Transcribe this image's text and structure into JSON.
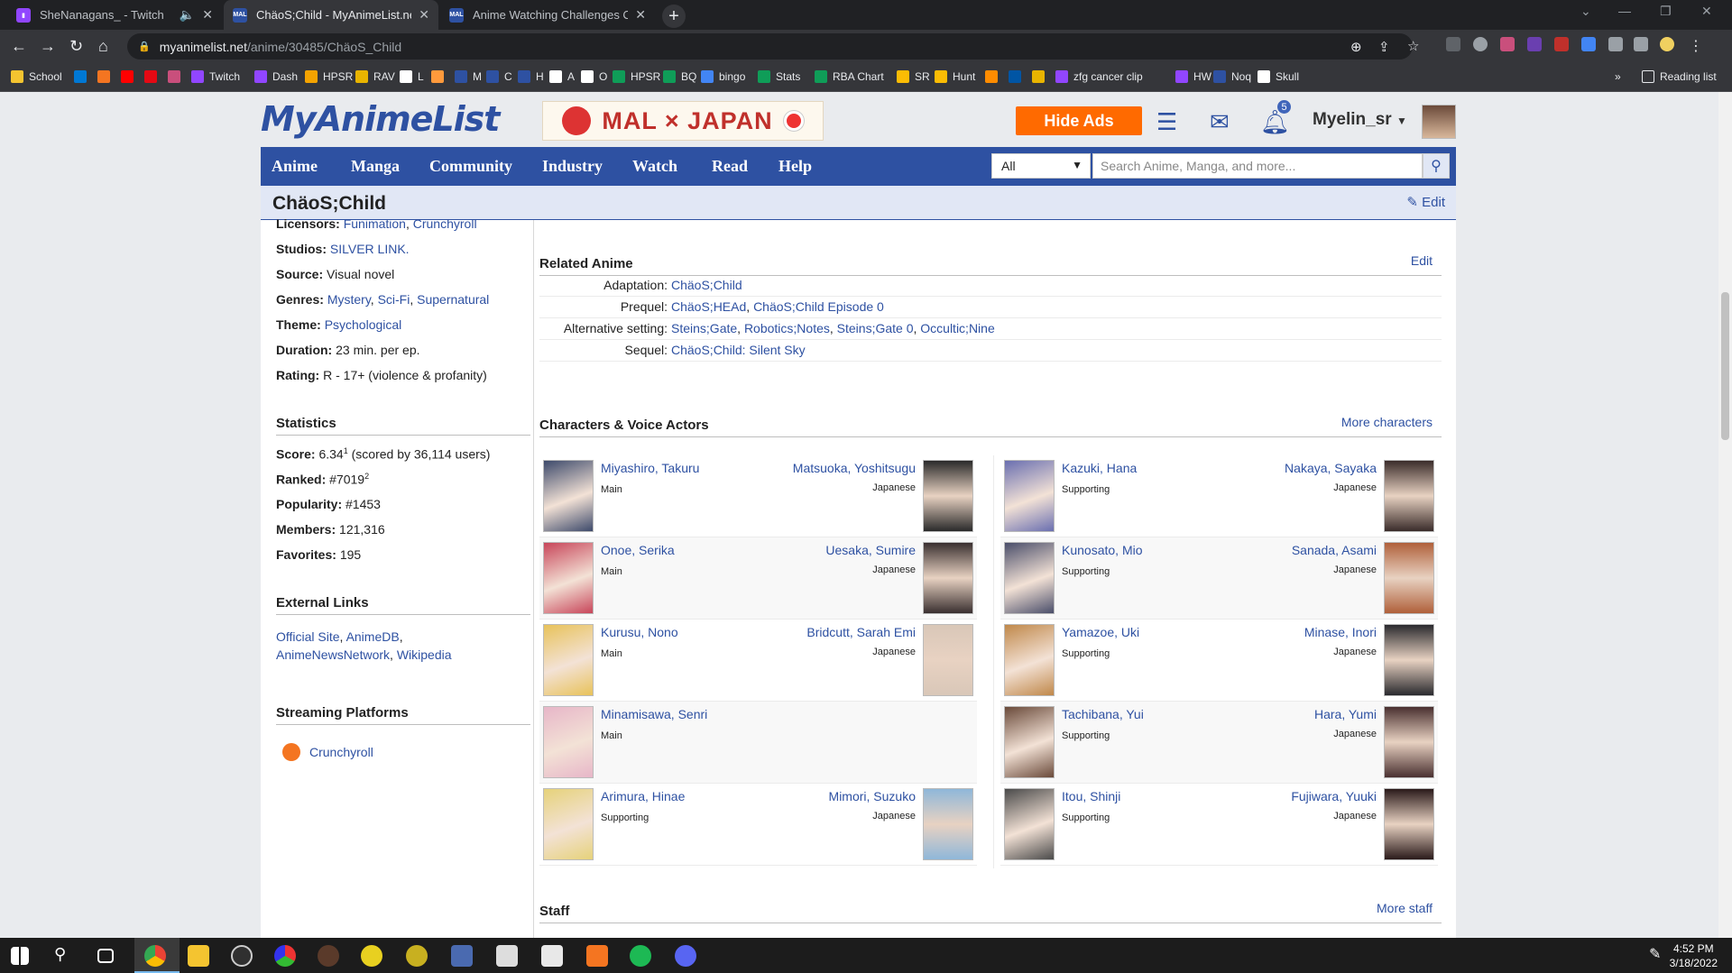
{
  "browser": {
    "tabs": [
      {
        "title": "SheNanagans_ - Twitch",
        "active": false,
        "color": "#9146ff"
      },
      {
        "title": "ChäoS;Child - MyAnimeList.net",
        "active": true,
        "color": "#2e51a2"
      },
      {
        "title": "Anime Watching Challenges Clu...",
        "active": false,
        "color": "#2e51a2"
      }
    ],
    "url_host": "myanimelist.net",
    "url_path": "/anime/30485/ChäoS_Child",
    "bookmarks": [
      {
        "label": "School",
        "color": "#f4c430"
      },
      {
        "label": "",
        "color": "#0078d4"
      },
      {
        "label": "",
        "color": "#f47521"
      },
      {
        "label": "",
        "color": "#ff0000"
      },
      {
        "label": "",
        "color": "#e50914"
      },
      {
        "label": "",
        "color": "#c94f7c"
      },
      {
        "label": "Twitch",
        "color": "#9146ff"
      },
      {
        "label": "Dash",
        "color": "#9146ff"
      },
      {
        "label": "HPSR",
        "color": "#f4a300"
      },
      {
        "label": "RAV",
        "color": "#e8b400"
      },
      {
        "label": "L",
        "color": "#ffffff"
      },
      {
        "label": "",
        "color": "#ff9a3c"
      },
      {
        "label": "M",
        "color": "#2e51a2"
      },
      {
        "label": "C",
        "color": "#2e51a2"
      },
      {
        "label": "H",
        "color": "#2e51a2"
      },
      {
        "label": "A",
        "color": "#ffffff"
      },
      {
        "label": "O",
        "color": "#ffffff"
      },
      {
        "label": "HPSR",
        "color": "#0f9d58"
      },
      {
        "label": "BQ",
        "color": "#0f9d58"
      },
      {
        "label": "bingo",
        "color": "#4285f4"
      },
      {
        "label": "Stats",
        "color": "#0f9d58"
      },
      {
        "label": "RBA Chart",
        "color": "#0f9d58"
      },
      {
        "label": "SR",
        "color": "#fbbc04"
      },
      {
        "label": "Hunt",
        "color": "#fbbc04"
      },
      {
        "label": "",
        "color": "#ff8c00"
      },
      {
        "label": "",
        "color": "#0055a4"
      },
      {
        "label": "",
        "color": "#e8b400"
      },
      {
        "label": "zfg cancer clip",
        "color": "#9146ff"
      },
      {
        "label": "HW",
        "color": "#9146ff"
      },
      {
        "label": "Noq",
        "color": "#2e51a2"
      },
      {
        "label": "Skull",
        "color": "#ffffff"
      }
    ],
    "bookmarks_overflow": "»",
    "reading_list": "Reading list"
  },
  "header": {
    "logo": "MyAnimeList",
    "banner": "MAL × JAPAN",
    "hide_ads": "Hide Ads",
    "notif_count": "5",
    "username": "Myelin_sr"
  },
  "nav": {
    "items": [
      "Anime",
      "Manga",
      "Community",
      "Industry",
      "Watch",
      "Read",
      "Help"
    ],
    "select_value": "All",
    "search_placeholder": "Search Anime, Manga, and more..."
  },
  "title": {
    "text": "ChäoS;Child",
    "edit": "Edit"
  },
  "info": {
    "licensors_label": "Licensors:",
    "licensors": [
      "Funimation",
      "Crunchyroll"
    ],
    "studios_label": "Studios:",
    "studios": "SILVER LINK.",
    "source_label": "Source:",
    "source": "Visual novel",
    "genres_label": "Genres:",
    "genres": [
      "Mystery",
      "Sci-Fi",
      "Supernatural"
    ],
    "theme_label": "Theme:",
    "theme": "Psychological",
    "duration_label": "Duration:",
    "duration": "23 min. per ep.",
    "rating_label": "Rating:",
    "rating": "R - 17+ (violence & profanity)"
  },
  "statistics": {
    "heading": "Statistics",
    "score_label": "Score:",
    "score": "6.34",
    "score_sup": "1",
    "score_note": "(scored by 36,114 users)",
    "ranked_label": "Ranked:",
    "ranked": "#7019",
    "ranked_sup": "2",
    "popularity_label": "Popularity:",
    "popularity": "#1453",
    "members_label": "Members:",
    "members": "121,316",
    "favorites_label": "Favorites:",
    "favorites": "195"
  },
  "external_links": {
    "heading": "External Links",
    "links": [
      "Official Site",
      "AnimeDB",
      "AnimeNewsNetwork",
      "Wikipedia"
    ]
  },
  "streaming": {
    "heading": "Streaming Platforms",
    "platforms": [
      "Crunchyroll"
    ]
  },
  "related": {
    "heading": "Related Anime",
    "edit": "Edit",
    "rows": [
      {
        "label": "Adaptation:",
        "values": [
          "ChäoS;Child"
        ]
      },
      {
        "label": "Prequel:",
        "values": [
          "ChäoS;HEAd",
          "ChäoS;Child Episode 0"
        ]
      },
      {
        "label": "Alternative setting:",
        "values": [
          "Steins;Gate",
          "Robotics;Notes",
          "Steins;Gate 0",
          "Occultic;Nine"
        ]
      },
      {
        "label": "Sequel:",
        "values": [
          "ChäoS;Child: Silent Sky"
        ]
      }
    ]
  },
  "characters": {
    "heading": "Characters & Voice Actors",
    "more": "More characters",
    "left": [
      {
        "name": "Miyashiro, Takuru",
        "role": "Main",
        "va": "Matsuoka, Yoshitsugu",
        "lang": "Japanese",
        "ccolor": "#3d4a6b",
        "vcolor": "#2a2a2a"
      },
      {
        "name": "Onoe, Serika",
        "role": "Main",
        "va": "Uesaka, Sumire",
        "lang": "Japanese",
        "ccolor": "#c8465a",
        "vcolor": "#3a3030"
      },
      {
        "name": "Kurusu, Nono",
        "role": "Main",
        "va": "Bridcutt, Sarah Emi",
        "lang": "Japanese",
        "ccolor": "#e8c25a",
        "vcolor": "#d9c7b8"
      },
      {
        "name": "Minamisawa, Senri",
        "role": "Main",
        "va": "",
        "lang": "",
        "ccolor": "#e7b6c8",
        "vcolor": ""
      },
      {
        "name": "Arimura, Hinae",
        "role": "Supporting",
        "va": "Mimori, Suzuko",
        "lang": "Japanese",
        "ccolor": "#e6d27a",
        "vcolor": "#8fb7d9"
      }
    ],
    "right": [
      {
        "name": "Kazuki, Hana",
        "role": "Supporting",
        "va": "Nakaya, Sayaka",
        "lang": "Japanese",
        "ccolor": "#6a6fb0",
        "vcolor": "#3a2c2a"
      },
      {
        "name": "Kunosato, Mio",
        "role": "Supporting",
        "va": "Sanada, Asami",
        "lang": "Japanese",
        "ccolor": "#4a4e6a",
        "vcolor": "#b0603a"
      },
      {
        "name": "Yamazoe, Uki",
        "role": "Supporting",
        "va": "Minase, Inori",
        "lang": "Japanese",
        "ccolor": "#c0884a",
        "vcolor": "#2a2a2e"
      },
      {
        "name": "Tachibana, Yui",
        "role": "Supporting",
        "va": "Hara, Yumi",
        "lang": "Japanese",
        "ccolor": "#6a4a3a",
        "vcolor": "#4a3030"
      },
      {
        "name": "Itou, Shinji",
        "role": "Supporting",
        "va": "Fujiwara, Yuuki",
        "lang": "Japanese",
        "ccolor": "#4a4a4a",
        "vcolor": "#2a1a1a"
      }
    ]
  },
  "staff": {
    "heading": "Staff",
    "more": "More staff"
  },
  "taskbar": {
    "time": "4:52 PM",
    "date": "3/18/2022"
  }
}
